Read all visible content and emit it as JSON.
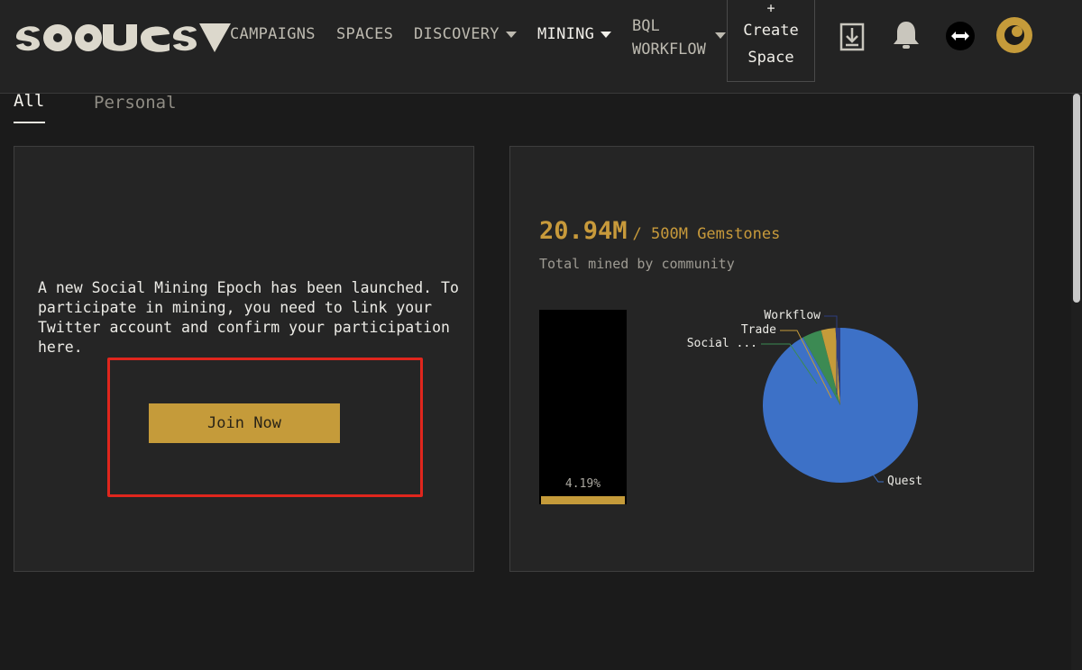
{
  "header": {
    "logo_text": "SOQUEST",
    "nav": {
      "campaigns": "CAMPAIGNS",
      "spaces": "SPACES",
      "discovery": "DISCOVERY",
      "mining": "MINING",
      "bql_line1": "BQL",
      "bql_line2": "WORKFLOW"
    },
    "create_plus": "+",
    "create_line1": "Create",
    "create_line2": "Space",
    "icons": [
      "download-icon",
      "bell-icon",
      "swap-arrows-icon",
      "profile-avatar-icon"
    ]
  },
  "tabs": {
    "all": "All",
    "personal": "Personal"
  },
  "left_card": {
    "description": "A new Social Mining Epoch has been launched. To participate in mining, you need to link your Twitter account and confirm your participation here.",
    "join_label": "Join Now"
  },
  "right_card": {
    "mined_value": "20.94M",
    "mined_total": "/ 500M Gemstones",
    "subtitle": "Total mined by community",
    "progress_percent_label": "4.19%"
  },
  "chart_data": {
    "type": "pie",
    "labels": [
      "Quest",
      "Social ...",
      "Trade",
      "Workflow"
    ],
    "values": [
      92,
      4,
      3,
      1
    ],
    "colors": [
      "#3d71c7",
      "#3c8a53",
      "#c59b3a",
      "#2d3d7e"
    ],
    "progress_fraction": 0.0419
  },
  "colors": {
    "accent": "#c59b3a",
    "highlight": "#e0261d",
    "pie_quest": "#3d71c7"
  }
}
